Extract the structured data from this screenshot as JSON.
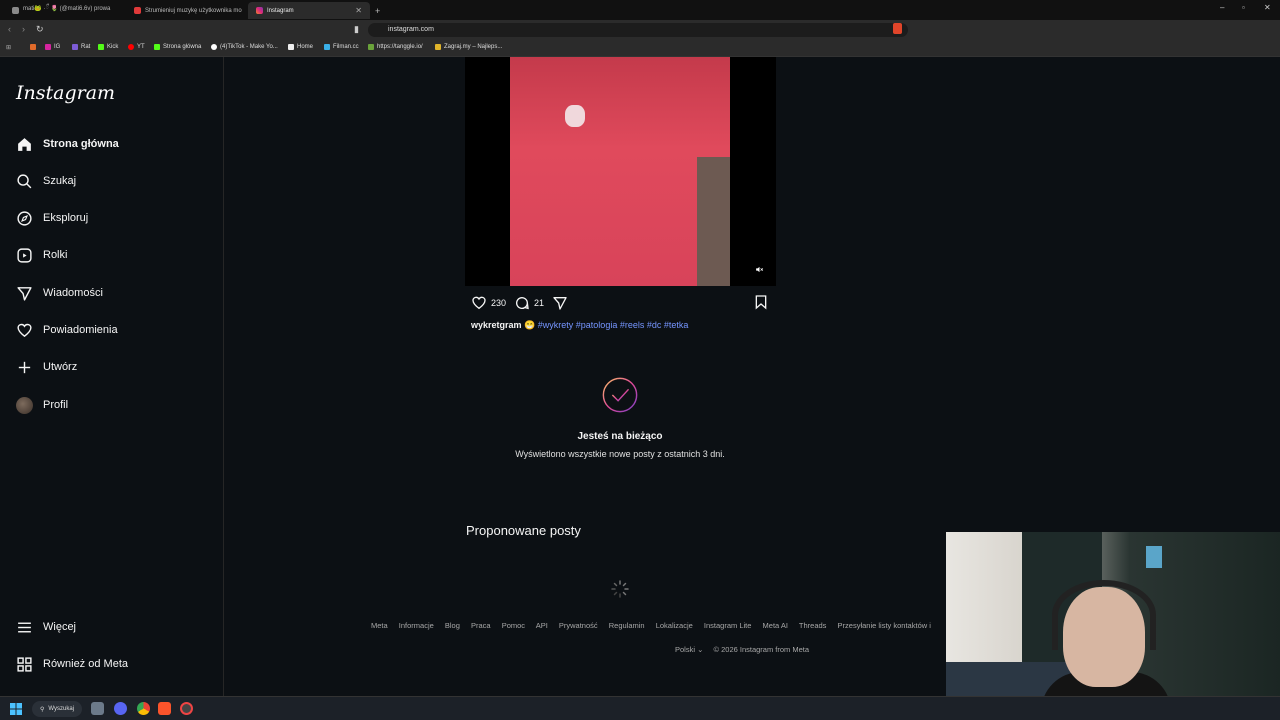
{
  "browser": {
    "tabs": [
      {
        "label": "mati🐸 ·ྀ 🌷 (@mati6.6v) prowa",
        "active": false,
        "color": "#8a8a8a"
      },
      {
        "label": "Strumieniuj muzykę użytkownika mo",
        "active": false,
        "color": "#e03a3a"
      },
      {
        "label": "Instagram",
        "active": true,
        "color": "#d6249f"
      }
    ],
    "new_tab": "+",
    "url": "instagram.com",
    "bookmarks": [
      "IG",
      "Rat",
      "Kick",
      "YT",
      "Strona główna",
      "(4)TikTok - Make Yo...",
      "Home",
      "Filman.cc",
      "https://tanggle.io/",
      "Zagraj.my – Najleps..."
    ]
  },
  "sidebar": {
    "logo": "Instagram",
    "items": [
      {
        "label": "Strona główna",
        "icon": "home-icon"
      },
      {
        "label": "Szukaj",
        "icon": "search-icon"
      },
      {
        "label": "Eksploruj",
        "icon": "compass-icon"
      },
      {
        "label": "Rolki",
        "icon": "reels-icon"
      },
      {
        "label": "Wiadomości",
        "icon": "messenger-icon"
      },
      {
        "label": "Powiadomienia",
        "icon": "heart-icon"
      },
      {
        "label": "Utwórz",
        "icon": "plus-icon"
      },
      {
        "label": "Profil",
        "icon": "avatar"
      }
    ],
    "more": "Więcej",
    "also_from_meta": "Również od Meta"
  },
  "post": {
    "likes": "230",
    "comments": "21",
    "author": "wykretgram",
    "emoji": "😁",
    "tags": "#wykrety #patologia #reels #dc #tetka"
  },
  "caught_up": {
    "title": "Jesteś na bieżąco",
    "subtitle": "Wyświetlono wszystkie nowe posty z ostatnich 3 dni."
  },
  "suggested_title": "Proponowane posty",
  "footer": {
    "links": [
      "Meta",
      "Informacje",
      "Blog",
      "Praca",
      "Pomoc",
      "API",
      "Prywatność",
      "Regulamin",
      "Lokalizacje",
      "Instagram Lite",
      "Meta AI",
      "Threads",
      "Przesyłanie listy kontaktów i"
    ],
    "language": "Polski",
    "copyright": "© 2026 Instagram from Meta"
  },
  "taskbar": {
    "search": "Wyszukaj"
  },
  "colors": {
    "accent_link": "#7595ff",
    "background": "#0c1014"
  }
}
